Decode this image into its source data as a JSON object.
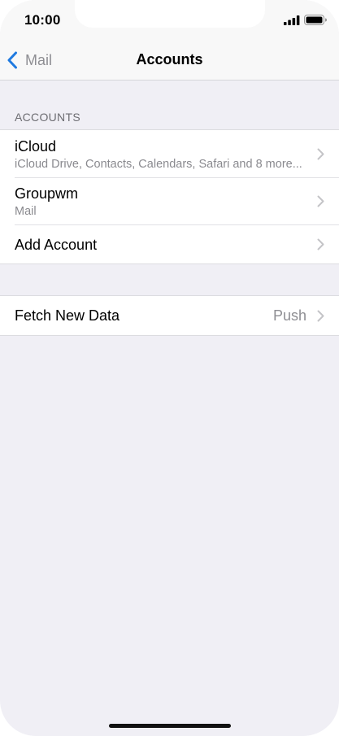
{
  "status_bar": {
    "time": "10:00",
    "icons": [
      "signal-icon",
      "battery-icon"
    ]
  },
  "nav": {
    "back_label": "Mail",
    "title": "Accounts",
    "icons": [
      "chevron-left-icon"
    ]
  },
  "accounts_section": {
    "header": "ACCOUNTS",
    "items": [
      {
        "title": "iCloud",
        "subtitle": "iCloud Drive, Contacts, Calendars, Safari and 8 more..."
      },
      {
        "title": "Groupwm",
        "subtitle": "Mail"
      },
      {
        "title": "Add Account"
      }
    ]
  },
  "fetch_section": {
    "title": "Fetch New Data",
    "value": "Push"
  },
  "colors": {
    "accent": "#1f7ae0",
    "background": "#f0eff5",
    "secondary_text": "#8e8e93"
  }
}
